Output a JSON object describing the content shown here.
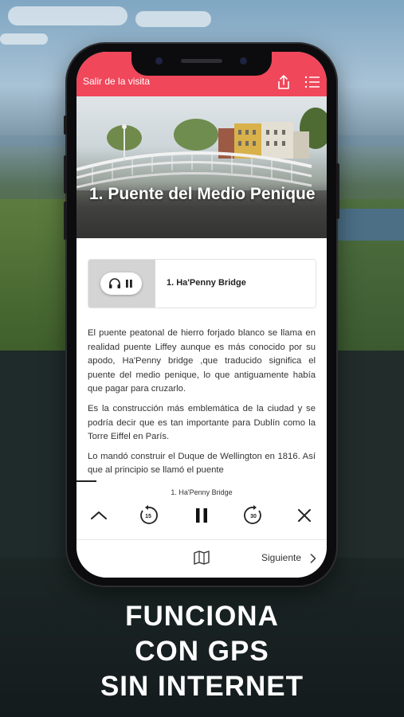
{
  "app": {
    "exit_label": "Salir de la visita",
    "share_icon": "share-icon",
    "menu_icon": "list-menu-icon"
  },
  "hero": {
    "title": "1. Puente del Medio Penique"
  },
  "audio_card": {
    "track_title": "1. Ha'Penny Bridge",
    "icons": [
      "headphones-icon",
      "pause-icon"
    ]
  },
  "article": {
    "paragraphs": [
      "El puente peatonal de hierro forjado blanco se llama en realidad puente Liffey aunque es más conocido por su apodo,   Ha'Penny bridge ,que traducido significa el puente del medio penique, lo que antiguamente había que pagar para cruzarlo.",
      "Es la construcción más emblemática de la ciudad y se podría decir que es tan importante para Dublín como la Torre Eiffel en París.",
      "Lo mandó construir el Duque de Wellington en 1816. Así que al principio se llamó el puente"
    ]
  },
  "player": {
    "track_title": "1. Ha'Penny Bridge",
    "rewind_seconds": "15",
    "forward_seconds": "30",
    "progress_fraction": 0.08,
    "icons": [
      "chevron-up-icon",
      "rewind-15-icon",
      "pause-icon",
      "forward-30-icon",
      "close-icon"
    ]
  },
  "footer": {
    "map_icon": "map-icon",
    "next_label": "Siguiente"
  },
  "promo": {
    "lines": [
      "FUNCIONA",
      "CON GPS",
      "SIN INTERNET"
    ]
  },
  "colors": {
    "accent": "#f0475a",
    "text": "#333333"
  }
}
